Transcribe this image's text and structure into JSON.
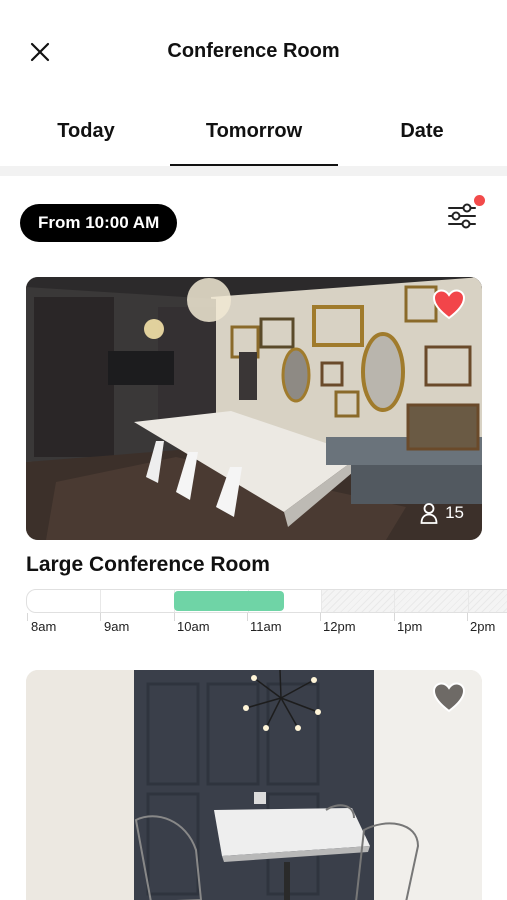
{
  "header": {
    "title": "Conference Room",
    "close_icon": "close-icon"
  },
  "tabs": [
    {
      "label": "Today",
      "active": false
    },
    {
      "label": "Tomorrow",
      "active": true
    },
    {
      "label": "Date",
      "active": false
    }
  ],
  "filters": {
    "from_label": "From 10:00 AM",
    "has_active_filters": true,
    "filter_icon": "sliders-icon"
  },
  "rooms": [
    {
      "name": "Large Conference Room",
      "capacity": "15",
      "favorite": true,
      "timeline": {
        "hours": [
          "8am",
          "9am",
          "10am",
          "11am",
          "12pm",
          "1pm",
          "2pm"
        ],
        "booked_range": [
          "10am",
          "11:30am"
        ],
        "unavailable_from": "12pm"
      }
    },
    {
      "name": "",
      "favorite": false
    }
  ],
  "colors": {
    "accent": "#6fd4a6",
    "favorite": "#f2454a",
    "notification_dot": "#f24a4a"
  }
}
